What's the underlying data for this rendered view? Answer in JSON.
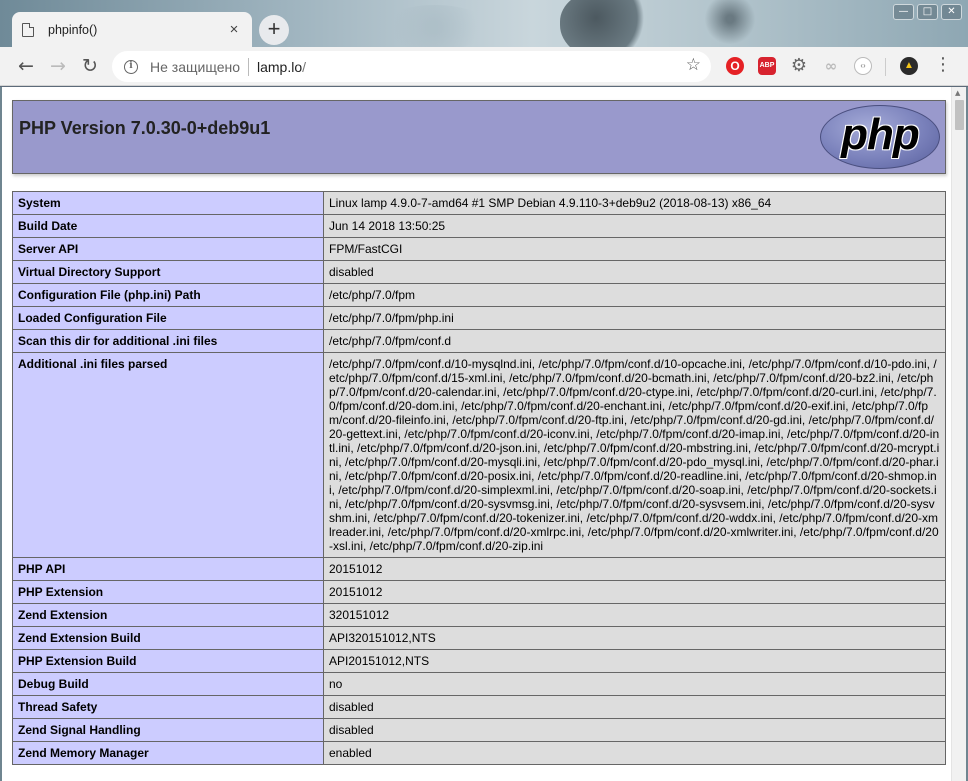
{
  "browser": {
    "tab_title": "phpinfo()",
    "tab_close": "×",
    "new_tab": "+",
    "window_controls": [
      "—",
      "□",
      "✕"
    ],
    "security_label": "Не защищено",
    "url_host": "lamp.lo",
    "url_path": "/",
    "extensions": [
      "opera-icon",
      "adblock-icon",
      "gear-icon",
      "link-icon",
      "code-icon",
      "linux-tux-icon"
    ],
    "ext_labels": {
      "opera": "O",
      "abp": "ABP",
      "code": "‹›",
      "tux": "🐧"
    }
  },
  "page": {
    "title": "PHP Version 7.0.30-0+deb9u1",
    "logo_text": "php",
    "rows": [
      {
        "key": "System",
        "value": "Linux lamp 4.9.0-7-amd64 #1 SMP Debian 4.9.110-3+deb9u2 (2018-08-13) x86_64"
      },
      {
        "key": "Build Date",
        "value": "Jun 14 2018 13:50:25"
      },
      {
        "key": "Server API",
        "value": "FPM/FastCGI"
      },
      {
        "key": "Virtual Directory Support",
        "value": "disabled"
      },
      {
        "key": "Configuration File (php.ini) Path",
        "value": "/etc/php/7.0/fpm"
      },
      {
        "key": "Loaded Configuration File",
        "value": "/etc/php/7.0/fpm/php.ini"
      },
      {
        "key": "Scan this dir for additional .ini files",
        "value": "/etc/php/7.0/fpm/conf.d"
      },
      {
        "key": "Additional .ini files parsed",
        "value": "/etc/php/7.0/fpm/conf.d/10-mysqlnd.ini, /etc/php/7.0/fpm/conf.d/10-opcache.ini, /etc/php/7.0/fpm/conf.d/10-pdo.ini, /etc/php/7.0/fpm/conf.d/15-xml.ini, /etc/php/7.0/fpm/conf.d/20-bcmath.ini, /etc/php/7.0/fpm/conf.d/20-bz2.ini, /etc/php/7.0/fpm/conf.d/20-calendar.ini, /etc/php/7.0/fpm/conf.d/20-ctype.ini, /etc/php/7.0/fpm/conf.d/20-curl.ini, /etc/php/7.0/fpm/conf.d/20-dom.ini, /etc/php/7.0/fpm/conf.d/20-enchant.ini, /etc/php/7.0/fpm/conf.d/20-exif.ini, /etc/php/7.0/fpm/conf.d/20-fileinfo.ini, /etc/php/7.0/fpm/conf.d/20-ftp.ini, /etc/php/7.0/fpm/conf.d/20-gd.ini, /etc/php/7.0/fpm/conf.d/20-gettext.ini, /etc/php/7.0/fpm/conf.d/20-iconv.ini, /etc/php/7.0/fpm/conf.d/20-imap.ini, /etc/php/7.0/fpm/conf.d/20-intl.ini, /etc/php/7.0/fpm/conf.d/20-json.ini, /etc/php/7.0/fpm/conf.d/20-mbstring.ini, /etc/php/7.0/fpm/conf.d/20-mcrypt.ini, /etc/php/7.0/fpm/conf.d/20-mysqli.ini, /etc/php/7.0/fpm/conf.d/20-pdo_mysql.ini, /etc/php/7.0/fpm/conf.d/20-phar.ini, /etc/php/7.0/fpm/conf.d/20-posix.ini, /etc/php/7.0/fpm/conf.d/20-readline.ini, /etc/php/7.0/fpm/conf.d/20-shmop.ini, /etc/php/7.0/fpm/conf.d/20-simplexml.ini, /etc/php/7.0/fpm/conf.d/20-soap.ini, /etc/php/7.0/fpm/conf.d/20-sockets.ini, /etc/php/7.0/fpm/conf.d/20-sysvmsg.ini, /etc/php/7.0/fpm/conf.d/20-sysvsem.ini, /etc/php/7.0/fpm/conf.d/20-sysvshm.ini, /etc/php/7.0/fpm/conf.d/20-tokenizer.ini, /etc/php/7.0/fpm/conf.d/20-wddx.ini, /etc/php/7.0/fpm/conf.d/20-xmlreader.ini, /etc/php/7.0/fpm/conf.d/20-xmlrpc.ini, /etc/php/7.0/fpm/conf.d/20-xmlwriter.ini, /etc/php/7.0/fpm/conf.d/20-xsl.ini, /etc/php/7.0/fpm/conf.d/20-zip.ini"
      },
      {
        "key": "PHP API",
        "value": "20151012"
      },
      {
        "key": "PHP Extension",
        "value": "20151012"
      },
      {
        "key": "Zend Extension",
        "value": "320151012"
      },
      {
        "key": "Zend Extension Build",
        "value": "API320151012,NTS"
      },
      {
        "key": "PHP Extension Build",
        "value": "API20151012,NTS"
      },
      {
        "key": "Debug Build",
        "value": "no"
      },
      {
        "key": "Thread Safety",
        "value": "disabled"
      },
      {
        "key": "Zend Signal Handling",
        "value": "disabled"
      },
      {
        "key": "Zend Memory Manager",
        "value": "enabled"
      }
    ]
  }
}
